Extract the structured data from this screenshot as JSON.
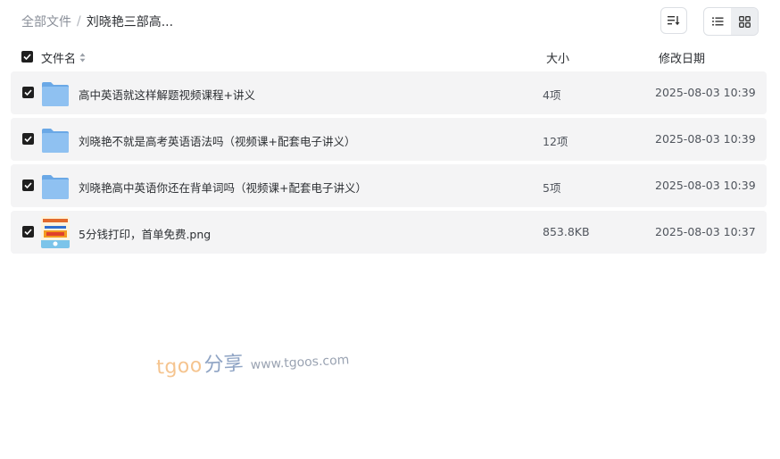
{
  "breadcrumb": {
    "root": "全部文件",
    "separator": "/",
    "current": "刘晓艳三部高..."
  },
  "toolbar": {
    "sort_icon": "sort-icon",
    "list_view_icon": "list-view-icon",
    "grid_view_icon": "grid-view-icon",
    "active_view": "grid"
  },
  "columns": {
    "name": "文件名",
    "size": "大小",
    "date": "修改日期"
  },
  "files": [
    {
      "name": "高中英语就这样解题视频课程+讲义",
      "size": "4项",
      "date": "2025-08-03 10:39",
      "type": "folder",
      "checked": true
    },
    {
      "name": "刘晓艳不就是高考英语语法吗（视频课+配套电子讲义）",
      "size": "12项",
      "date": "2025-08-03 10:39",
      "type": "folder",
      "checked": true
    },
    {
      "name": "刘晓艳高中英语你还在背单词吗（视频课+配套电子讲义）",
      "size": "5项",
      "date": "2025-08-03 10:39",
      "type": "folder",
      "checked": true
    },
    {
      "name": "5分钱打印，首单免费.png",
      "size": "853.8KB",
      "date": "2025-08-03 10:37",
      "type": "image",
      "checked": true
    }
  ],
  "watermark": {
    "brand": "tgoo",
    "cn": "分享",
    "url": "www.tgoos.com"
  },
  "colors": {
    "folder": "#7fb6ec",
    "row_bg": "#f4f4f5",
    "checkbox": "#1f1f1f"
  }
}
